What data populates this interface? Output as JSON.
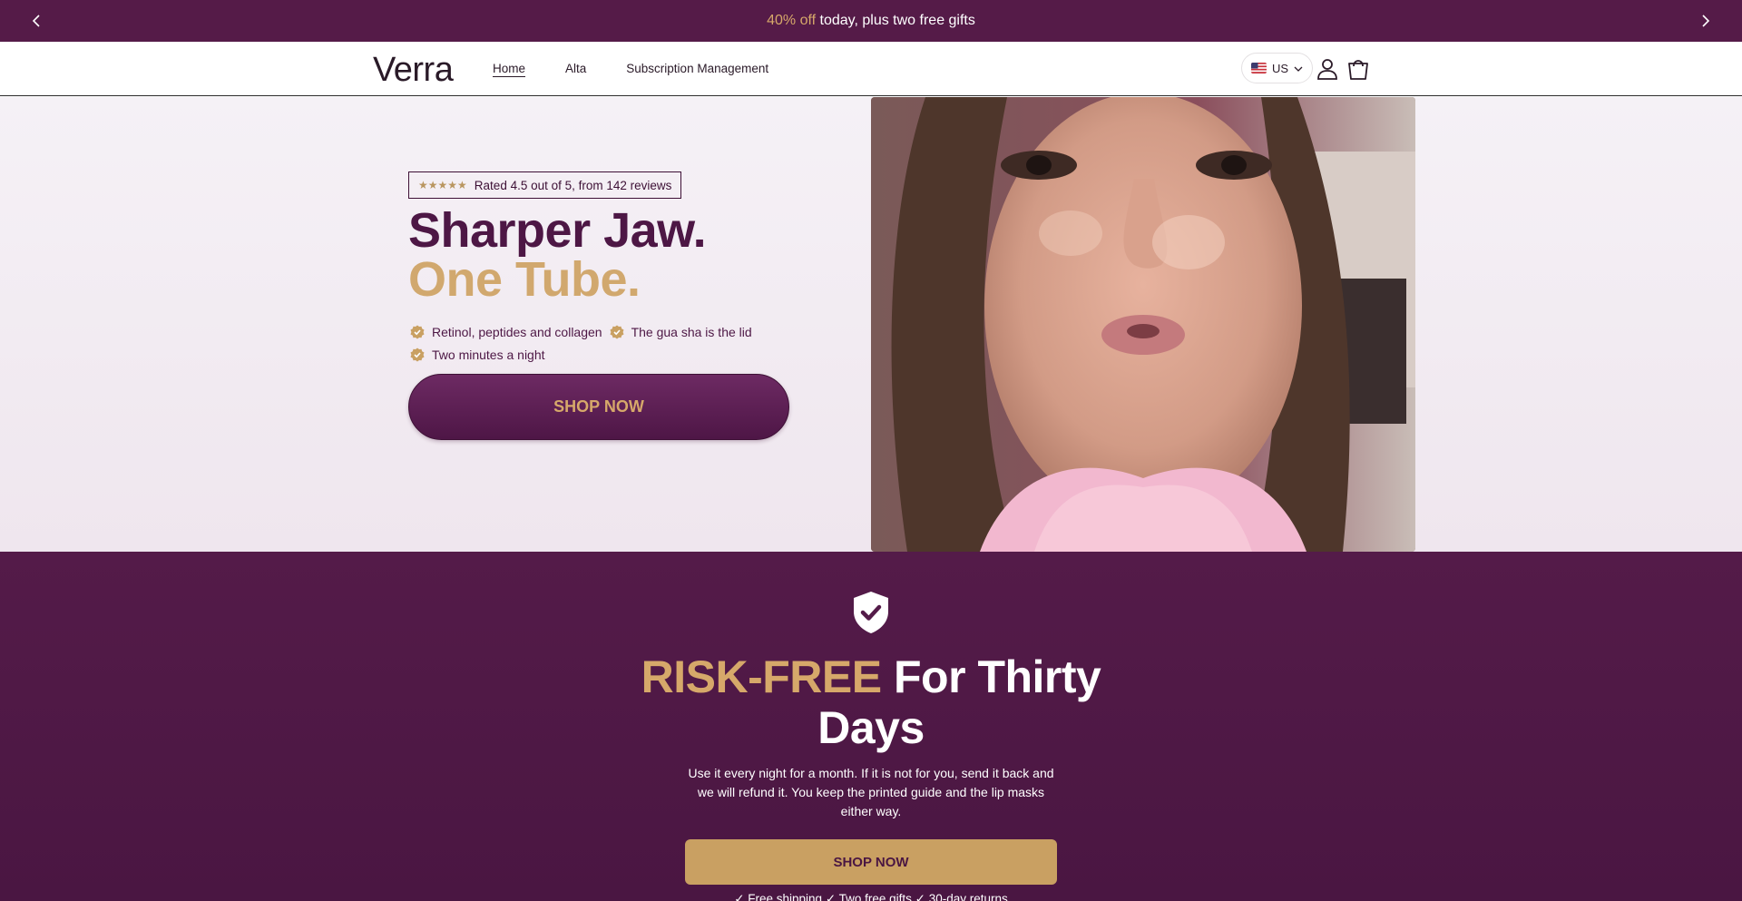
{
  "announcement": {
    "accent_text": "40% off",
    "text": "today, plus two free gifts",
    "prev_icon": "chevron-left-icon",
    "next_icon": "chevron-right-icon"
  },
  "header": {
    "logo": "Verra",
    "nav": [
      {
        "label": "Home",
        "active": true
      },
      {
        "label": "Alta",
        "active": false
      },
      {
        "label": "Subscription Management",
        "active": false
      }
    ],
    "locale": "US",
    "icons": [
      "flag-us-icon",
      "chevron-down-icon",
      "account-icon",
      "cart-icon"
    ]
  },
  "hero": {
    "rating_text": "Rated 4.5 out of 5, from 142 reviews",
    "rating_stars": "★★★★★",
    "headline_main": "Sharper Jaw.",
    "headline_gold": "One Tube.",
    "features": [
      "Retinol, peptides and collagen",
      "The gua sha is the lid",
      "Two minutes a night"
    ],
    "cta": "SHOP NOW"
  },
  "risk": {
    "icon": "shield-check-icon",
    "title_gold": "RISK-FREE",
    "title_rest": "For Thirty Days",
    "body": "Use it every night for a month. If it is not for you, send it back and we will refund it. You keep the printed guide and the lip masks either way.",
    "cta": "SHOP NOW",
    "perks": "✓ Free shipping   ✓ Two free gifts   ✓ 30-day returns"
  },
  "colors": {
    "brand_plum": "#551b48",
    "gold": "#d6a86a",
    "hero_bg": "#f5f1f6"
  }
}
